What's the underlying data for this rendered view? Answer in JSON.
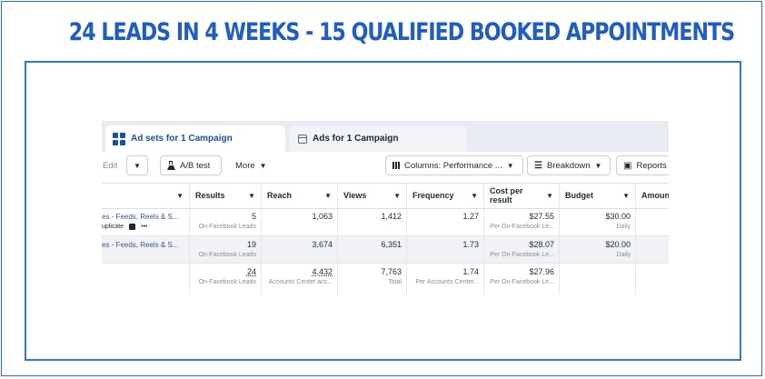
{
  "headline": "24 Leads in 4 Weeks - 15 Qualified Booked Appointments",
  "colors": {
    "brand_blue": "#1f5cc4",
    "frame_blue": "#2f7bd0",
    "link_blue": "#385898"
  },
  "tabs": [
    {
      "label": "Ad sets for 1 Campaign",
      "icon": "adsets-icon",
      "active": true
    },
    {
      "label": "Ads for 1 Campaign",
      "icon": "calendar-icon",
      "active": false
    }
  ],
  "toolbar": {
    "edit": "Edit",
    "ab_test": "A/B test",
    "more": "More",
    "columns": "Columns: Performance ...",
    "breakdown": "Breakdown",
    "reports": "Reports"
  },
  "columns": [
    "Results",
    "Reach",
    "Views",
    "Frequency",
    "Cost per result",
    "Budget",
    "Amoun"
  ],
  "rows": [
    {
      "name": "es - Feeds, Reels & S...",
      "sub": "uplicate",
      "sub_more": "•••",
      "results": "5",
      "results_sub": "On-Facebook Leads",
      "reach": "1,063",
      "views": "1,412",
      "frequency": "1.27",
      "cost": "$27.55",
      "cost_sub": "Per On-Facebook Le...",
      "budget": "$30.00",
      "budget_sub": "Daily"
    },
    {
      "name": "es - Feeds, Reels & S...",
      "results": "19",
      "results_sub": "On-Facebook Leads",
      "reach": "3,674",
      "views": "6,351",
      "frequency": "1.73",
      "cost": "$28.07",
      "cost_sub": "Per On-Facebook Le...",
      "budget": "$20.00",
      "budget_sub": "Daily"
    }
  ],
  "totals": {
    "results": "24",
    "results_sub": "On-Facebook Leads",
    "reach": "4,432",
    "reach_sub": "Accounts Center acc...",
    "views": "7,763",
    "views_sub": "Total",
    "frequency": "1.74",
    "frequency_sub": "Per Accounts Center...",
    "cost": "$27.96",
    "cost_sub": "Per On-Facebook Le..."
  }
}
